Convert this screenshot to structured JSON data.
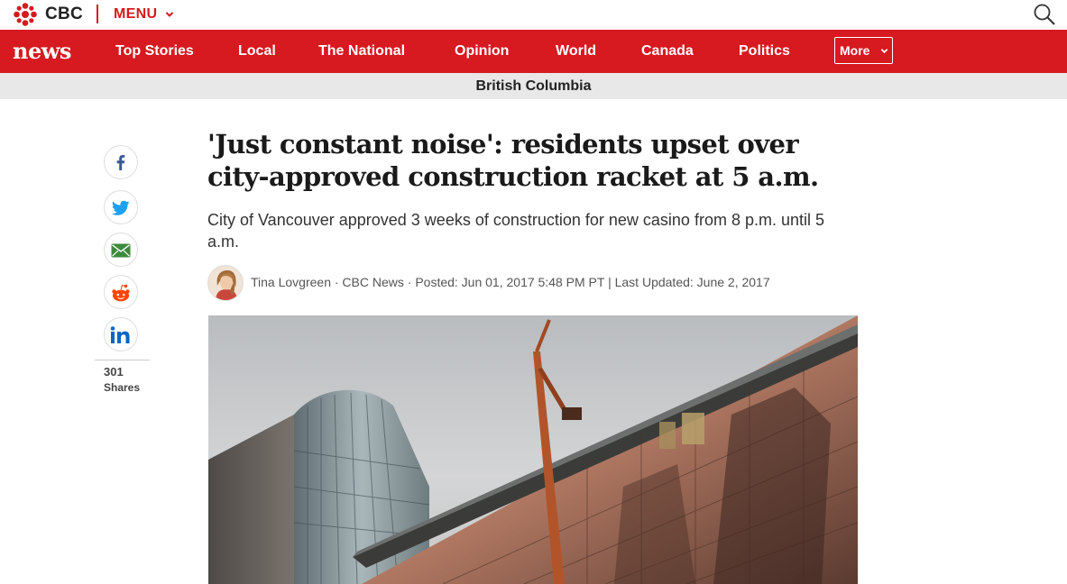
{
  "header": {
    "brand": "CBC",
    "menu_label": "MENU"
  },
  "nav": {
    "logo_text": "news",
    "items": [
      "Top Stories",
      "Local",
      "The National",
      "Opinion",
      "World",
      "Canada",
      "Politics"
    ],
    "more_label": "More"
  },
  "section": {
    "title": "British Columbia"
  },
  "share": {
    "count": "301",
    "label": "Shares",
    "icons": [
      "facebook-icon",
      "twitter-icon",
      "email-icon",
      "reddit-icon",
      "linkedin-icon"
    ]
  },
  "article": {
    "headline": "'Just constant noise': residents upset over city-approved construction racket at 5 a.m.",
    "dek": "City of Vancouver approved 3 weeks of construction for new casino from 8 p.m. until 5 a.m.",
    "byline": "Tina Lovgreen · CBC News · Posted: Jun 01, 2017 5:48 PM PT | Last Updated: June 2, 2017"
  },
  "colors": {
    "brand_red": "#d71920",
    "section_bg": "#e8e8e8"
  }
}
